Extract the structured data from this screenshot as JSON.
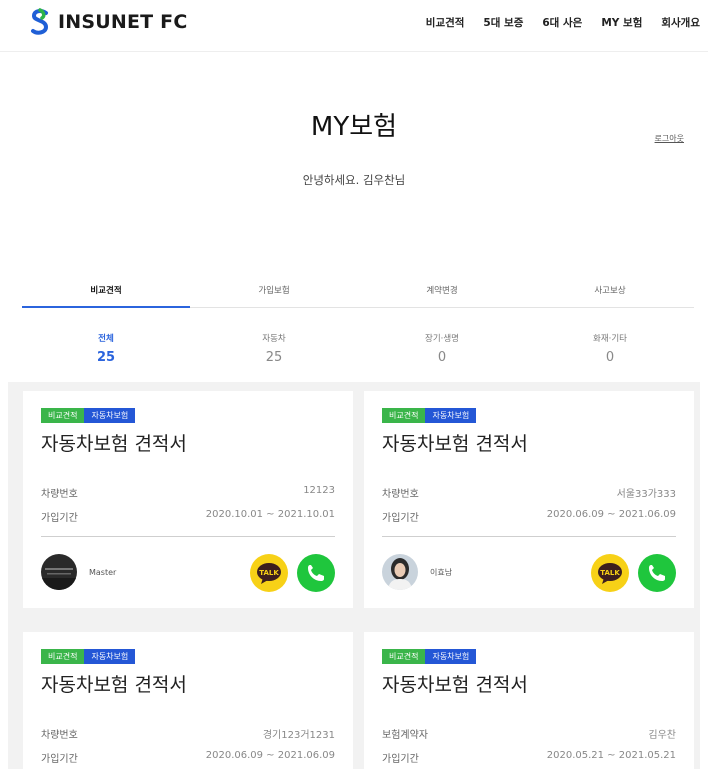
{
  "header": {
    "logo_text": "INSUNET FC",
    "nav": [
      "비교견적",
      "5대 보증",
      "6대 사은",
      "MY 보험",
      "회사개요"
    ]
  },
  "page": {
    "title": "MY보험",
    "logout": "로그아웃",
    "greeting": "안녕하세요. 김우찬님"
  },
  "tabs": [
    "비교견적",
    "가입보험",
    "계약변경",
    "사고보상"
  ],
  "categories": [
    {
      "label": "전체",
      "count": "25"
    },
    {
      "label": "자동차",
      "count": "25"
    },
    {
      "label": "장기·생명",
      "count": "0"
    },
    {
      "label": "화재·기타",
      "count": "0"
    }
  ],
  "cards": [
    {
      "badges": [
        "비교견적",
        "자동차보험"
      ],
      "title": "자동차보험 견적서",
      "rows": [
        {
          "label": "차량번호",
          "value": "12123"
        },
        {
          "label": "가입기간",
          "value": "2020.10.01 ~ 2021.10.01"
        }
      ],
      "agent": "Master"
    },
    {
      "badges": [
        "비교견적",
        "자동차보험"
      ],
      "title": "자동차보험 견적서",
      "rows": [
        {
          "label": "차량번호",
          "value": "서울33가333"
        },
        {
          "label": "가입기간",
          "value": "2020.06.09 ~ 2021.06.09"
        }
      ],
      "agent": "이효남"
    },
    {
      "badges": [
        "비교견적",
        "자동차보험"
      ],
      "title": "자동차보험 견적서",
      "rows": [
        {
          "label": "차량번호",
          "value": "경기123거1231"
        },
        {
          "label": "가입기간",
          "value": "2020.06.09 ~ 2021.06.09"
        }
      ]
    },
    {
      "badges": [
        "비교견적",
        "자동차보험"
      ],
      "title": "자동차보험 견적서",
      "rows": [
        {
          "label": "보험계약자",
          "value": "김우찬"
        },
        {
          "label": "가입기간",
          "value": "2020.05.21 ~ 2021.05.21"
        }
      ]
    }
  ],
  "buttons": {
    "talk_label": "TALK"
  },
  "colors": {
    "accent": "#2b64dd",
    "badge_green": "#3ab54a",
    "badge_blue": "#2457d6",
    "talk": "#f7d117",
    "call": "#1fc63d"
  },
  "icons": [
    "insunet-logo-icon",
    "kakao-talk-icon",
    "phone-icon",
    "avatar"
  ]
}
